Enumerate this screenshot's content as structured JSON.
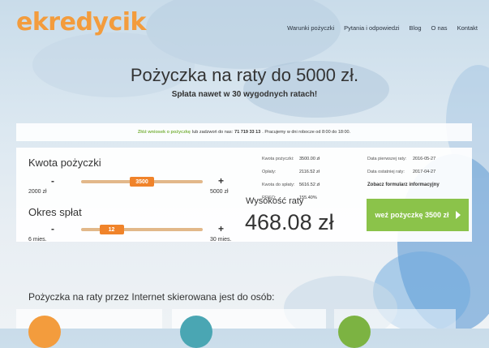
{
  "header": {
    "logo": "ekredycik",
    "nav": [
      "Warunki pożyczki",
      "Pytania i odpowiedzi",
      "Blog",
      "O nas",
      "Kontakt"
    ]
  },
  "hero": {
    "title": "Pożyczka na raty do 5000 zł.",
    "subtitle": "Spłata nawet w 30 wygodnych ratach!"
  },
  "info": {
    "link": "Złóż wniosek o pożyczkę",
    "text1": "lub zadzwoń do nas:",
    "phone": "71 719 33 13",
    "text2": ". Pracujemy w dni robocze od 8:00 do 18:00."
  },
  "calc": {
    "amount": {
      "label": "Kwota pożyczki",
      "minus": "-",
      "plus": "+",
      "value": "3500",
      "min": "2000 zł",
      "max": "5000 zł",
      "fraction": 0.5
    },
    "period": {
      "label": "Okres spłat",
      "minus": "-",
      "plus": "+",
      "value": "12",
      "min": "6 mies.",
      "max": "30 mies.",
      "fraction": 0.25
    },
    "details": [
      {
        "k": "Kwota pożyczki:",
        "v": "3500.00 zł"
      },
      {
        "k": "Opłaty:",
        "v": "2116.52 zł"
      },
      {
        "k": "Kwota do spłaty:",
        "v": "5616.52 zł"
      },
      {
        "k": "RRSO:",
        "v": "155.40%"
      }
    ],
    "dates": [
      {
        "k": "Data pierwszej raty:",
        "v": "2016-05-27"
      },
      {
        "k": "Data ostatniej raty:",
        "v": "2017-04-27"
      }
    ],
    "form_link": "Zobacz formularz informacyjny",
    "rate_label": "Wysokość raty",
    "rate_value": "468.08 zł",
    "cta": "weź pożyczkę 3500 zł"
  },
  "section": {
    "title": "Pożyczka na raty przez Internet skierowana jest do osób:"
  },
  "colors": {
    "accent": "#f39c3d",
    "slider": "#f0832a",
    "cta": "#8bc34a",
    "link": "#7cb342"
  }
}
